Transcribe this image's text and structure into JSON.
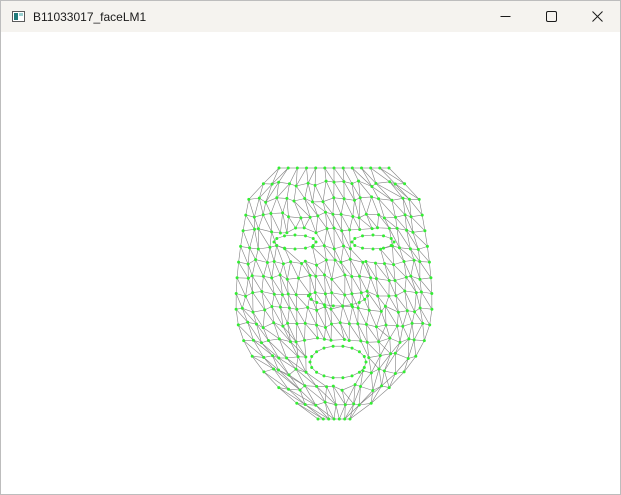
{
  "window": {
    "title": "B11033017_faceLM1",
    "app_icon": "window-app-icon",
    "controls": [
      {
        "name": "minimize-button",
        "icon": "minimize-icon"
      },
      {
        "name": "maximize-button",
        "icon": "maximize-icon"
      },
      {
        "name": "close-button",
        "icon": "close-icon"
      }
    ]
  },
  "viewport": {
    "background": "#ffffff",
    "mesh_color": "#808080",
    "landmark_color": "#33ee33"
  }
}
